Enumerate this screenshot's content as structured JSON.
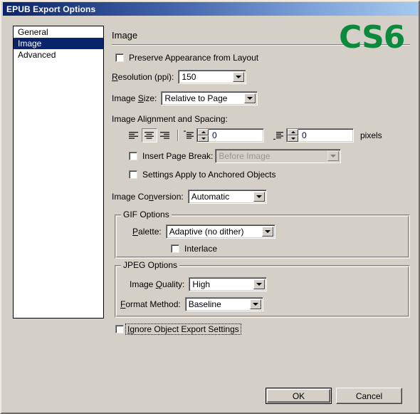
{
  "window": {
    "title": "EPUB Export Options",
    "brand_badge": "CS6",
    "brand_color": "#0b8a3c",
    "titlebar_color": "#0a246a",
    "dialog_bg": "#d4d0c8"
  },
  "sidebar": {
    "items": [
      {
        "label": "General",
        "selected": false
      },
      {
        "label": "Image",
        "selected": true
      },
      {
        "label": "Advanced",
        "selected": false
      }
    ]
  },
  "panel": {
    "section_title": "Image",
    "preserve_appearance": {
      "label": "Preserve Appearance from Layout",
      "checked": false
    },
    "resolution": {
      "label_pre": "R",
      "label_post": "esolution (ppi):",
      "value": "150"
    },
    "image_size": {
      "label_pre": "Image ",
      "label_mid": "S",
      "label_post": "ize:",
      "value": "Relative to Page"
    },
    "alignment_spacing": {
      "label": "Image Alignment and Spacing:",
      "align_left_icon": "align-left-icon",
      "align_center_icon": "align-center-icon",
      "align_right_icon": "align-right-icon",
      "selected_alignment": "center",
      "space_before_icon": "space-before-icon",
      "space_before_value": "0",
      "space_after_icon": "space-after-icon",
      "space_after_value": "0",
      "units_label": "pixels"
    },
    "insert_page_break": {
      "label": "Insert Page Break:",
      "checked": false,
      "value": "Before Image",
      "disabled": true
    },
    "settings_apply_anchored": {
      "label": "Settings Apply to Anchored Objects",
      "checked": false
    },
    "image_conversion": {
      "label_pre": "Image Co",
      "label_mid": "n",
      "label_post": "version:",
      "value": "Automatic"
    },
    "gif_options": {
      "legend": "GIF Options",
      "palette": {
        "label_pre": "P",
        "label_post": "alette:",
        "value": "Adaptive (no dither)"
      },
      "interlace": {
        "label": "Interlace",
        "checked": false
      }
    },
    "jpeg_options": {
      "legend": "JPEG Options",
      "image_quality": {
        "label_pre": "Image ",
        "label_mid": "Q",
        "label_post": "uality:",
        "value": "High"
      },
      "format_method": {
        "label_pre": "F",
        "label_post": "ormat Method:",
        "value": "Baseline"
      }
    },
    "ignore_object_export": {
      "label_pre": "I",
      "label_post": "gnore Object Export Settings",
      "checked": false,
      "focused": true
    }
  },
  "footer": {
    "ok_label": "OK",
    "cancel_label": "Cancel"
  }
}
